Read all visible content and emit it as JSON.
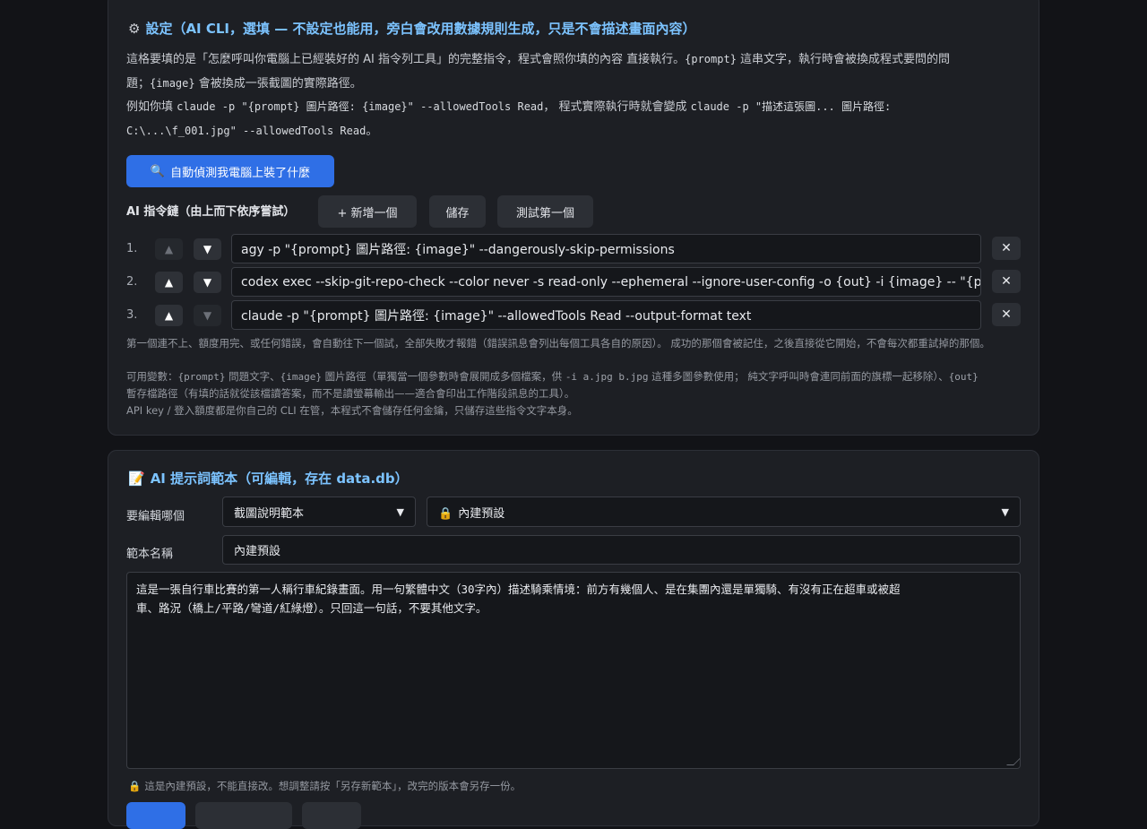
{
  "settings": {
    "icon": "gear-icon",
    "title": "設定（AI CLI，選填 — 不設定也能用，旁白會改用數據規則生成，只是不會描述畫面內容）",
    "desc1_a": "這格要填的是「怎麼呼叫你電腦上已經裝好的 AI 指令列工具」的完整指令，程式會照你填的內容 直接執行。",
    "desc1_prompt": "{prompt}",
    "desc1_b": " 這串文字，執行時會被換成程式要問的問",
    "desc1_c": "題；",
    "desc1_image": "{image}",
    "desc1_d": " 會被換成一張截圖的實際路徑。",
    "desc2_a": "例如你填 ",
    "desc2_example": "claude -p \"{prompt} 圖片路徑: {image}\" --allowedTools Read",
    "desc2_b": "， 程式實際執行時就會變成 ",
    "desc2_result1": "claude -p \"描述這張圖... 圖片路徑:",
    "desc2_result2": "C:\\...\\f_001.jpg\" --allowedTools Read",
    "desc2_c": "。",
    "detect_icon": "magnifier-icon",
    "detect_label": "自動偵測我電腦上裝了什麼",
    "chain_label": "AI 指令鏈（由上而下依序嘗試）",
    "add_label": "+ 新增一個",
    "save_label": "儲存",
    "test_label": "測試第一個",
    "up_arrow": "▲",
    "down_arrow": "▼",
    "remove_glyph": "✕",
    "commands": [
      {
        "num": "1.",
        "value": "agy -p \"{prompt} 圖片路徑: {image}\" --dangerously-skip-permissions",
        "up_disabled": true,
        "down_disabled": false
      },
      {
        "num": "2.",
        "value": "codex exec --skip-git-repo-check --color never -s read-only --ephemeral --ignore-user-config -o {out} -i {image} -- \"{prompt}\"",
        "up_disabled": false,
        "down_disabled": false
      },
      {
        "num": "3.",
        "value": "claude -p \"{prompt} 圖片路徑: {image}\" --allowedTools Read --output-format text",
        "up_disabled": false,
        "down_disabled": true
      }
    ],
    "note1": "第一個連不上、額度用完、或任何錯誤，會自動往下一個試，全部失敗才報錯（錯誤訊息會列出每個工具各自的原因）。 成功的那個會被記住，之後直接從它開始，不會每次都重試掉的那個。",
    "note2_a": "可用變數：",
    "note2_prompt": "{prompt}",
    "note2_b": " 問題文字、",
    "note2_image": "{image}",
    "note2_c": " 圖片路徑（單獨當一個參數時會展開成多個檔案，供 ",
    "note2_ex": "-i a.jpg b.jpg",
    "note2_d": " 這種多圖參數使用； 純文字呼叫時會連同前面的旗標一起移除）、",
    "note2_out": "{out}",
    "note3": "暫存檔路徑（有填的話就從該檔讀答案，而不是讀螢幕輸出——適合會印出工作階段訊息的工具）。",
    "note4": "API key / 登入額度都是你自己的 CLI 在管，本程式不會儲存任何金鑰，只儲存這些指令文字本身。"
  },
  "prompt_tpl": {
    "icon": "memo-icon",
    "title": "AI 提示詞範本（可編輯，存在 data.db）",
    "edit_label": "要編輯哪個",
    "template_select": "截圖說明範本",
    "version_icon": "lock-icon",
    "version_select": "內建預設",
    "name_label": "範本名稱",
    "name_value": "內建預設",
    "body": "這是一張自行車比賽的第一人稱行車紀錄畫面。用一句繁體中文（30字內）描述騎乘情境：前方有幾個人、是在集團內還是單獨騎、有沒有正在超車或被超\n車、路況（橋上/平路/彎道/紅綠燈）。只回這一句話，不要其他文字。",
    "lock_note_icon": "lock-icon",
    "lock_note": "這是內建預設，不能直接改。想調整請按「另存新範本」，改完的版本會另存一份。"
  },
  "colors": {
    "accent": "#2f6fe6",
    "title": "#7cc3ff",
    "background": "#121317",
    "card": "#1d1f24"
  }
}
